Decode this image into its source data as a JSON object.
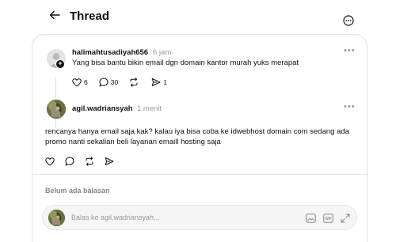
{
  "header": {
    "title": "Thread"
  },
  "post1": {
    "username": "halimahtusadiyah656",
    "time": "6 jam",
    "text": "Yang bisa bantu bikin email dgn domain kantor murah yuks merapat",
    "likes": "6",
    "comments": "30",
    "shares": "1"
  },
  "post2": {
    "username": "agil.wadriansyah",
    "time": "1 menit",
    "text": "rencanya hanya email saja kak? kalau iya bisa coba ke idwebhost domain com sedang ada promo nanti sekalian beli layanan emaill hosting saja"
  },
  "replies": {
    "empty_label": "Belum ada balasan"
  },
  "reply_box": {
    "placeholder": "Balas ke agil.wadriansyah...",
    "gif_label": "GIF"
  },
  "icons": {
    "back": "arrow-left-icon",
    "more": "more-circle-icon",
    "like": "heart-icon",
    "comment": "comment-icon",
    "repost": "repost-icon",
    "share": "send-icon"
  }
}
